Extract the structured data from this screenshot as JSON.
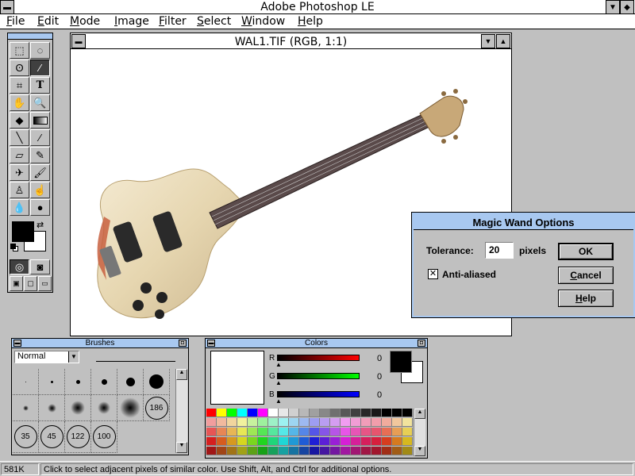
{
  "app": {
    "title": "Adobe Photoshop LE"
  },
  "menu": [
    "File",
    "Edit",
    "Mode",
    "Image",
    "Filter",
    "Select",
    "Window",
    "Help"
  ],
  "document": {
    "title": "WAL1.TIF  (RGB, 1:1)"
  },
  "dialog": {
    "title": "Magic Wand Options",
    "tolerance_label": "Tolerance:",
    "tolerance_value": "20",
    "tolerance_unit": "pixels",
    "antialiased_label": "Anti-aliased",
    "antialiased_checked": true,
    "ok_label": "OK",
    "cancel_label": "Cancel",
    "help_label": "Help"
  },
  "brushes": {
    "title": "Brushes",
    "mode": "Normal",
    "ring_sizes": [
      "186",
      "35",
      "45",
      "122",
      "100"
    ]
  },
  "colors": {
    "title": "Colors",
    "r_label": "R",
    "r_value": "0",
    "g_label": "G",
    "g_value": "0",
    "b_label": "B",
    "b_value": "0",
    "foreground": "#000000",
    "background": "#ffffff"
  },
  "status": {
    "memory": "581K",
    "hint": "Click to select adjacent pixels of similar color. Use Shift, Alt, and Ctrl for additional options."
  },
  "colors_theme": {
    "title_accent": "#a8c8f0",
    "chrome": "#c0c0c0"
  }
}
